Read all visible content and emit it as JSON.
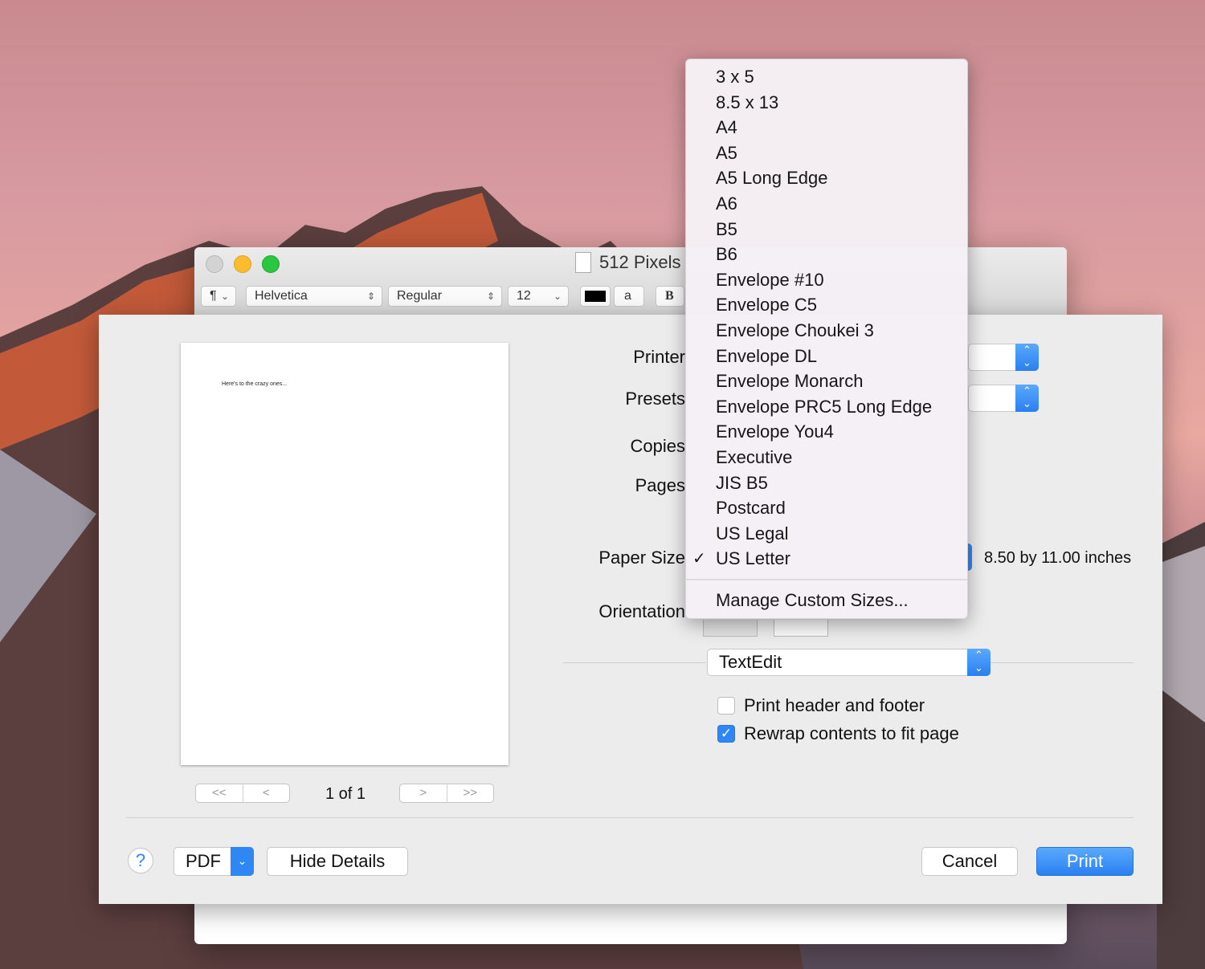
{
  "window": {
    "title": "512 Pixels",
    "toolbar": {
      "paragraph": "¶",
      "font": "Helvetica",
      "style": "Regular",
      "size": "12",
      "bold": "B",
      "highlight_glyph": "a"
    }
  },
  "print_dialog": {
    "preview_text": "Here's to the crazy ones...",
    "pagination": {
      "first": "<<",
      "prev": "<",
      "indicator": "1 of 1",
      "next": ">",
      "last": ">>"
    },
    "labels": {
      "printer": "Printer",
      "presets": "Presets",
      "copies": "Copies",
      "pages": "Pages",
      "paper_size": "Paper Size",
      "orientation": "Orientation"
    },
    "paper_size_value": "8.50 by 11.00 inches",
    "section_popup": "TextEdit",
    "options": [
      {
        "label": "Print header and footer",
        "checked": false
      },
      {
        "label": "Rewrap contents to fit page",
        "checked": true
      }
    ],
    "buttons": {
      "help": "?",
      "pdf": "PDF",
      "hide_details": "Hide Details",
      "cancel": "Cancel",
      "print": "Print"
    }
  },
  "paper_menu": {
    "items": [
      "3 x 5",
      "8.5 x 13",
      "A4",
      "A5",
      "A5 Long Edge",
      "A6",
      "B5",
      "B6",
      "Envelope #10",
      "Envelope C5",
      "Envelope Choukei 3",
      "Envelope DL",
      "Envelope Monarch",
      "Envelope PRC5 Long Edge",
      "Envelope You4",
      "Executive",
      "JIS B5",
      "Postcard",
      "US Legal",
      "US Letter"
    ],
    "selected": "US Letter",
    "checkmark": "✓",
    "manage": "Manage Custom Sizes..."
  },
  "colors": {
    "accent": "#2f86f5",
    "close": "#cfcfcf",
    "minimize": "#fdbc2e",
    "zoom": "#2ac840"
  }
}
